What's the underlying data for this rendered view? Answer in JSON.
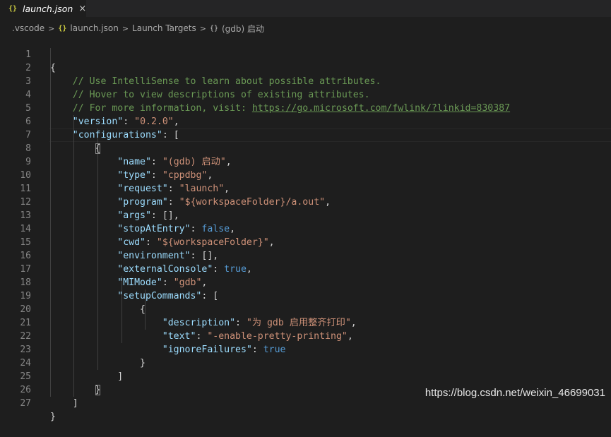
{
  "tab": {
    "icon": "{}",
    "title": "launch.json",
    "close": "×"
  },
  "breadcrumb": {
    "folder": ".vscode",
    "file_icon": "{}",
    "file": "launch.json",
    "section": "Launch Targets",
    "object_icon": "{}",
    "object": "(gdb) 启动"
  },
  "editor": {
    "line_numbers": [
      "1",
      "2",
      "3",
      "4",
      "5",
      "6",
      "7",
      "8",
      "9",
      "10",
      "11",
      "12",
      "13",
      "14",
      "15",
      "16",
      "17",
      "18",
      "19",
      "20",
      "21",
      "22",
      "23",
      "24",
      "25",
      "26",
      "27"
    ],
    "code": {
      "l1": "{",
      "l2": "// Use IntelliSense to learn about possible attributes.",
      "l3": "// Hover to view descriptions of existing attributes.",
      "l4_comment": "// For more information, visit: ",
      "l4_link": "https://go.microsoft.com/fwlink/?linkid=830387",
      "version_key": "\"version\"",
      "version_val": "\"0.2.0\"",
      "configurations_key": "\"configurations\"",
      "open_bracket": "[",
      "open_brace": "{",
      "name_key": "\"name\"",
      "name_val": "\"(gdb) 启动\"",
      "type_key": "\"type\"",
      "type_val": "\"cppdbg\"",
      "request_key": "\"request\"",
      "request_val": "\"launch\"",
      "program_key": "\"program\"",
      "program_val": "\"${workspaceFolder}/a.out\"",
      "args_key": "\"args\"",
      "args_val": "[]",
      "stopAtEntry_key": "\"stopAtEntry\"",
      "stopAtEntry_val": "false",
      "cwd_key": "\"cwd\"",
      "cwd_val": "\"${workspaceFolder}\"",
      "environment_key": "\"environment\"",
      "environment_val": "[]",
      "externalConsole_key": "\"externalConsole\"",
      "externalConsole_val": "true",
      "MIMode_key": "\"MIMode\"",
      "MIMode_val": "\"gdb\"",
      "setupCommands_key": "\"setupCommands\"",
      "description_key": "\"description\"",
      "description_val": "\"为 gdb 启用整齐打印\"",
      "text_key": "\"text\"",
      "text_val": "\"-enable-pretty-printing\"",
      "ignoreFailures_key": "\"ignoreFailures\"",
      "ignoreFailures_val": "true",
      "close_brace": "}",
      "close_bracket": "]"
    }
  },
  "watermark": "https://blog.csdn.net/weixin_46699031",
  "colors": {
    "background": "#1e1e1e",
    "key": "#9cdcfe",
    "string": "#ce9178",
    "comment": "#6a9955",
    "boolean": "#569cd6",
    "punctuation": "#d4d4d4",
    "line_number": "#858585",
    "json_icon": "#cbcb41"
  }
}
